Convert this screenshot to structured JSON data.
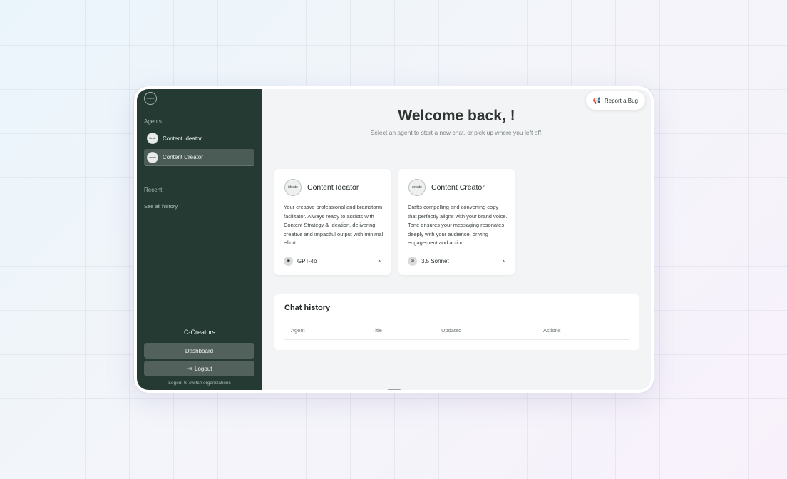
{
  "sidebar": {
    "logo_text": "creators",
    "agents_label": "Agents",
    "agents": [
      {
        "label": "Content Ideator",
        "avatar": "ideate"
      },
      {
        "label": "Content Creator",
        "avatar": "create"
      }
    ],
    "recent_label": "Recent",
    "see_all_label": "See all history",
    "org_name": "C-Creators",
    "dashboard_label": "Dashboard",
    "logout_label": "Logout",
    "logout_hint": "Logout to switch organizations"
  },
  "header": {
    "report_label": "Report a Bug",
    "welcome": "Welcome back, !",
    "subtitle": "Select an agent to start a new chat, or pick up where you left off."
  },
  "cards": [
    {
      "title": "Content Ideator",
      "avatar": "ideate",
      "description": "Your creative professional and brainstorm facilitator. Always ready to assists with Content Strategy & Ideation, delivering creative and impactful output with minimal effort.",
      "model": "GPT-4o",
      "model_icon": "openai-icon"
    },
    {
      "title": "Content Creator",
      "avatar": "create",
      "description": "Crafts compelling and converting copy that perfectly aligns with your brand voice. Tone ensures your messaging resonates deeply with your audience, driving engagement and action.",
      "model": "3.5 Sonnet",
      "model_icon": "anthropic-icon"
    }
  ],
  "history": {
    "title": "Chat history",
    "columns": [
      "Agent",
      "Title",
      "Updated",
      "Actions"
    ]
  },
  "colors": {
    "sidebar_bg": "#253a33",
    "main_bg": "#f3f4f5",
    "button_bg": "#52615b"
  }
}
